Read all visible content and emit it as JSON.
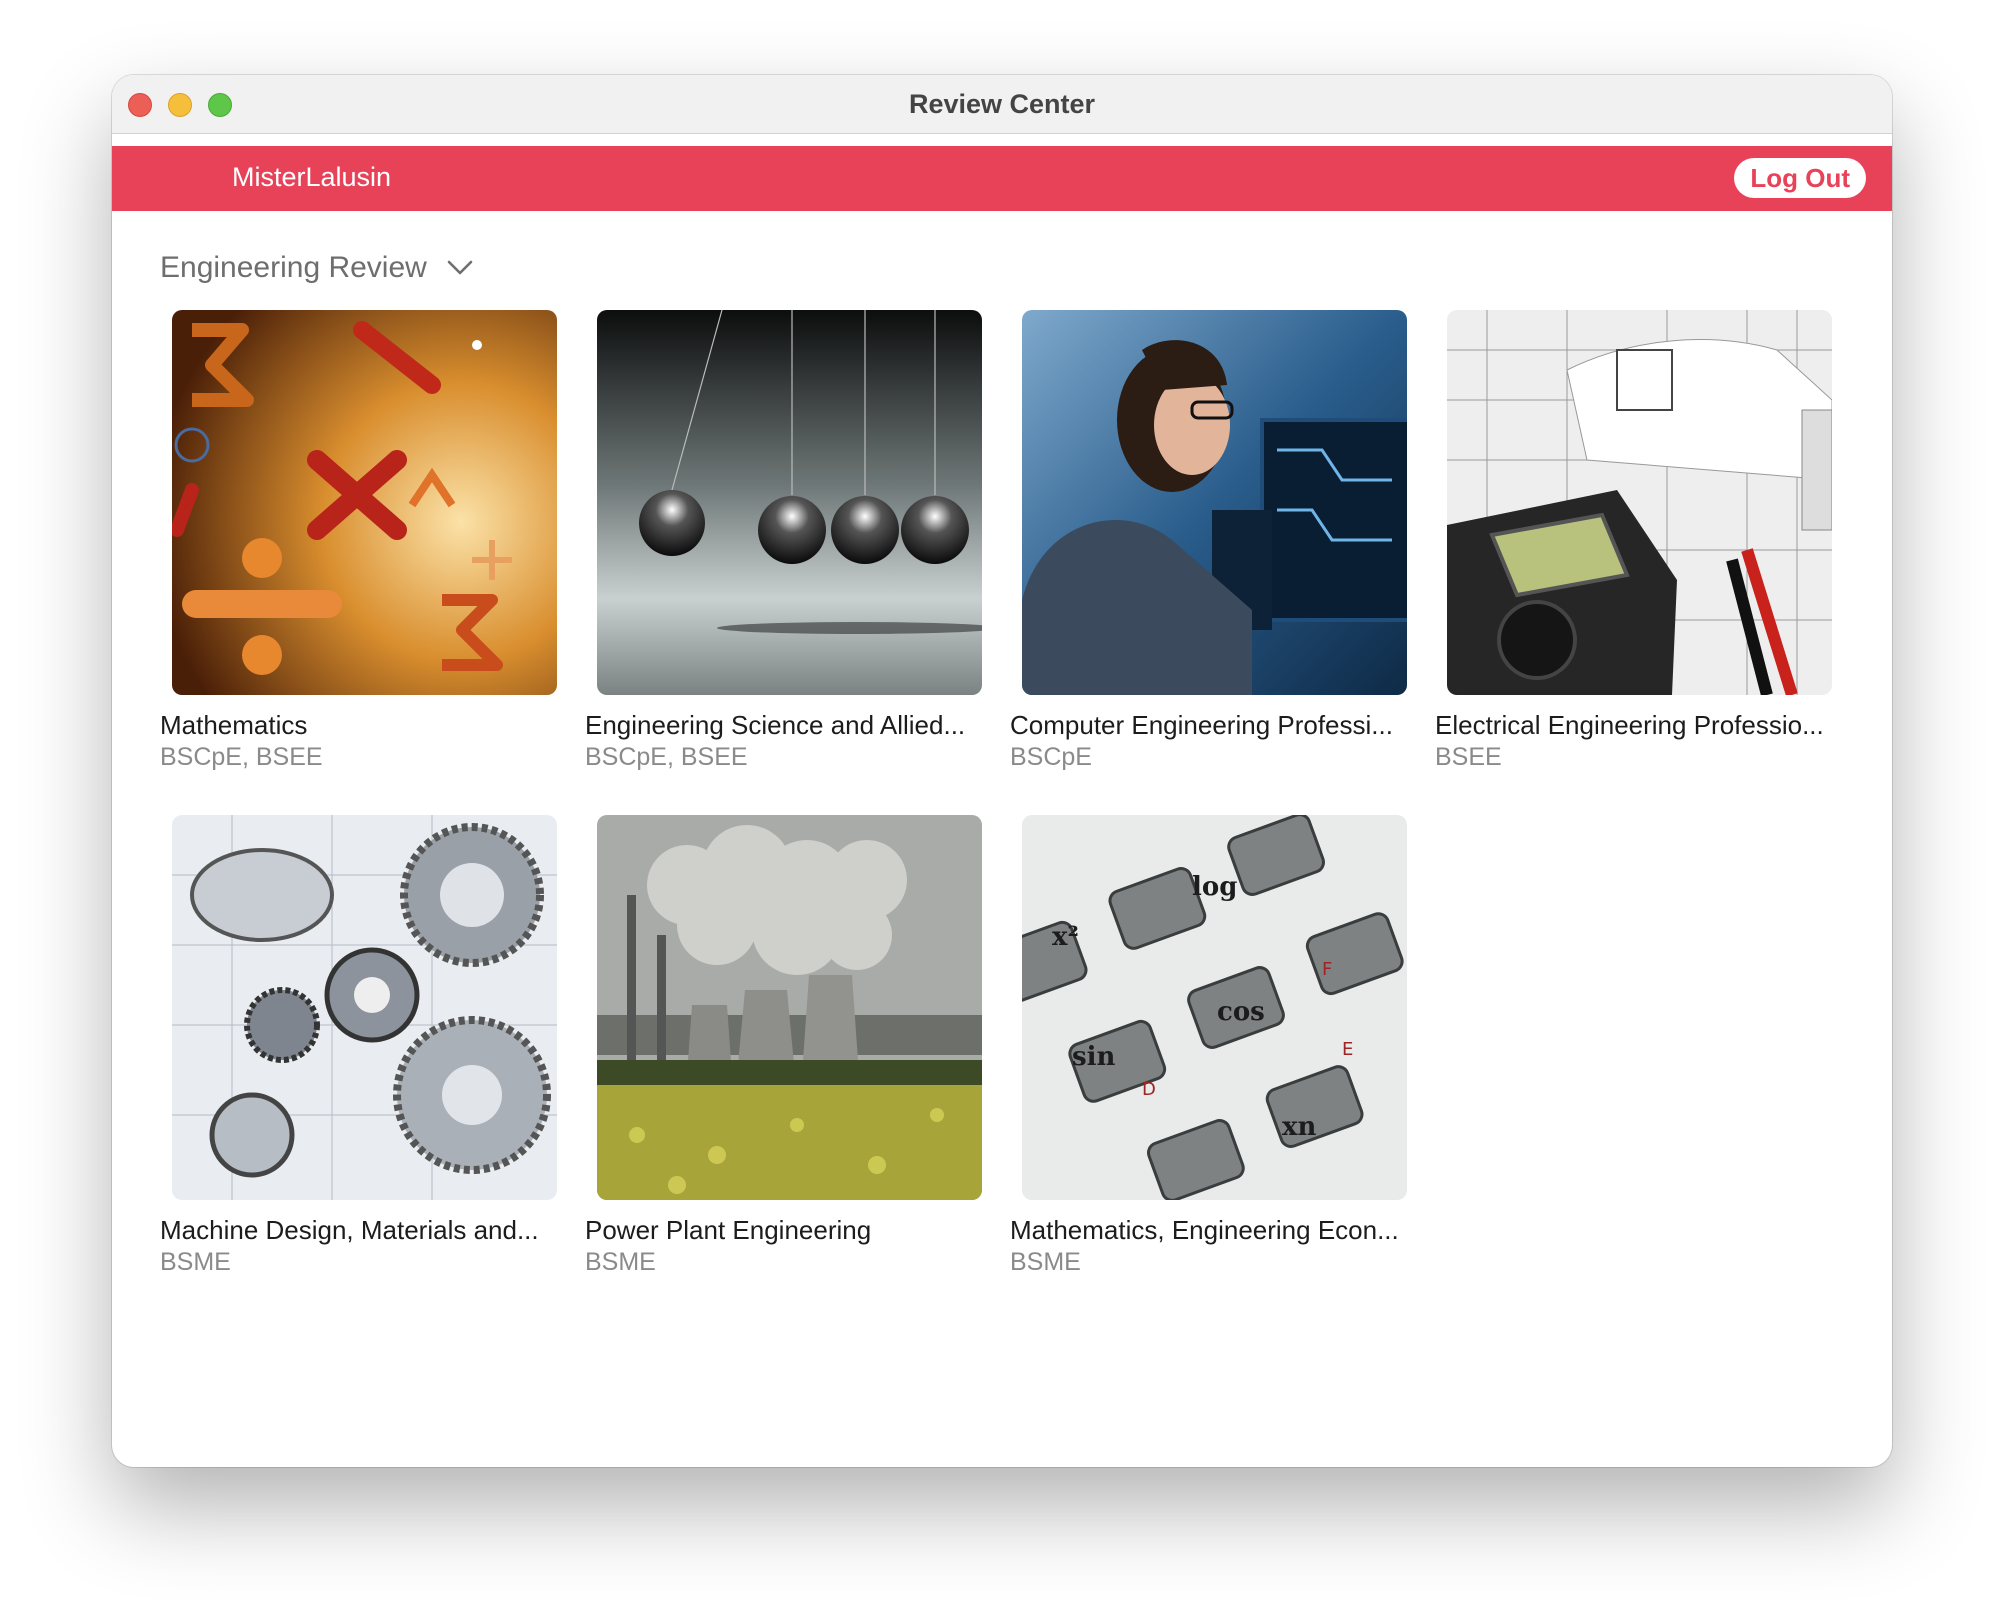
{
  "window": {
    "title": "Review Center"
  },
  "header": {
    "username": "MisterLalusin",
    "logout_label": "Log Out",
    "accent_color": "#e84259"
  },
  "category": {
    "selected": "Engineering Review"
  },
  "courses": [
    {
      "title": "Mathematics",
      "programs": "BSCpE, BSEE",
      "image": "math-symbols-image"
    },
    {
      "title": "Engineering Science and Allied...",
      "programs": "BSCpE, BSEE",
      "image": "newtons-cradle-image"
    },
    {
      "title": "Computer Engineering Professi...",
      "programs": "BSCpE",
      "image": "engineer-at-computer-image"
    },
    {
      "title": "Electrical Engineering Professio...",
      "programs": "BSEE",
      "image": "multimeter-blueprint-image"
    },
    {
      "title": "Machine Design, Materials and...",
      "programs": "BSME",
      "image": "gears-blueprint-image"
    },
    {
      "title": "Power Plant Engineering",
      "programs": "BSME",
      "image": "power-plant-image"
    },
    {
      "title": "Mathematics, Engineering Econ...",
      "programs": "BSME",
      "image": "calculator-keys-image"
    }
  ]
}
